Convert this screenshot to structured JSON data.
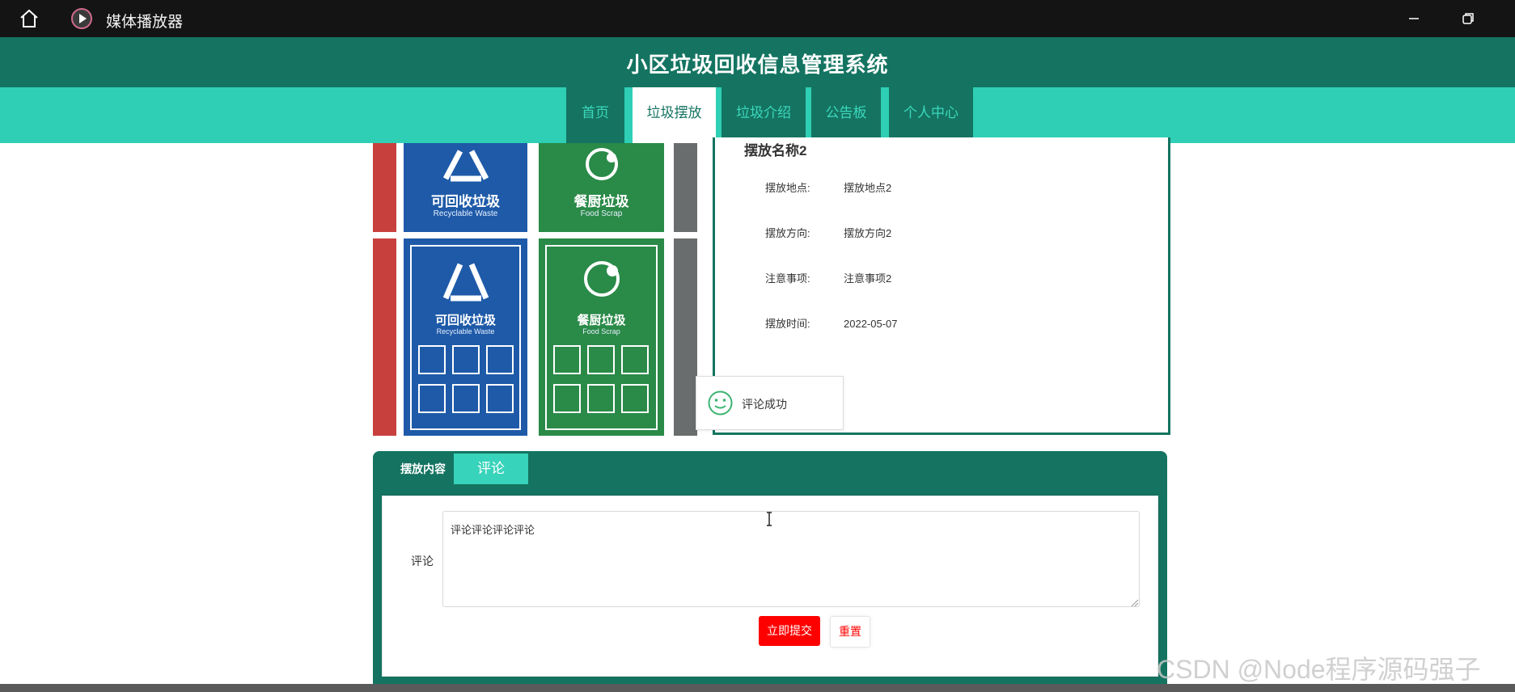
{
  "titlebar": {
    "title": "媒体播放器",
    "icons": [
      "home-icon",
      "media-player-icon",
      "minimize-icon",
      "restore-icon"
    ]
  },
  "header": {
    "title": "小区垃圾回收信息管理系统"
  },
  "nav": {
    "items": [
      {
        "label": "首页",
        "active": false
      },
      {
        "label": "垃圾摆放",
        "active": true
      },
      {
        "label": "垃圾介绍",
        "active": false
      },
      {
        "label": "公告板",
        "active": false
      },
      {
        "label": "个人中心",
        "active": false
      }
    ]
  },
  "image": {
    "bins": [
      {
        "label": "可回收垃圾",
        "sub": "Recyclable Waste",
        "color": "#1e5aa8"
      },
      {
        "label": "餐厨垃圾",
        "sub": "Food Scrap",
        "color": "#2a8a48"
      }
    ]
  },
  "detail": {
    "name": "摆放名称2",
    "rows": [
      {
        "label": "摆放地点:",
        "value": "摆放地点2"
      },
      {
        "label": "摆放方向:",
        "value": "摆放方向2"
      },
      {
        "label": "注意事项:",
        "value": "注意事项2"
      },
      {
        "label": "摆放时间:",
        "value": "2022-05-07"
      }
    ]
  },
  "toast": {
    "message": "评论成功"
  },
  "tabs": {
    "content_label": "摆放内容",
    "comment_label": "评论"
  },
  "form": {
    "comment_label": "评论",
    "comment_value": "评论评论评论评论",
    "submit_label": "立即提交",
    "reset_label": "重置"
  },
  "watermark": "CSDN @Node程序源码强子",
  "colors": {
    "header": "#147461",
    "nav_bar": "#2ecfb4",
    "submit": "#ff0000"
  }
}
